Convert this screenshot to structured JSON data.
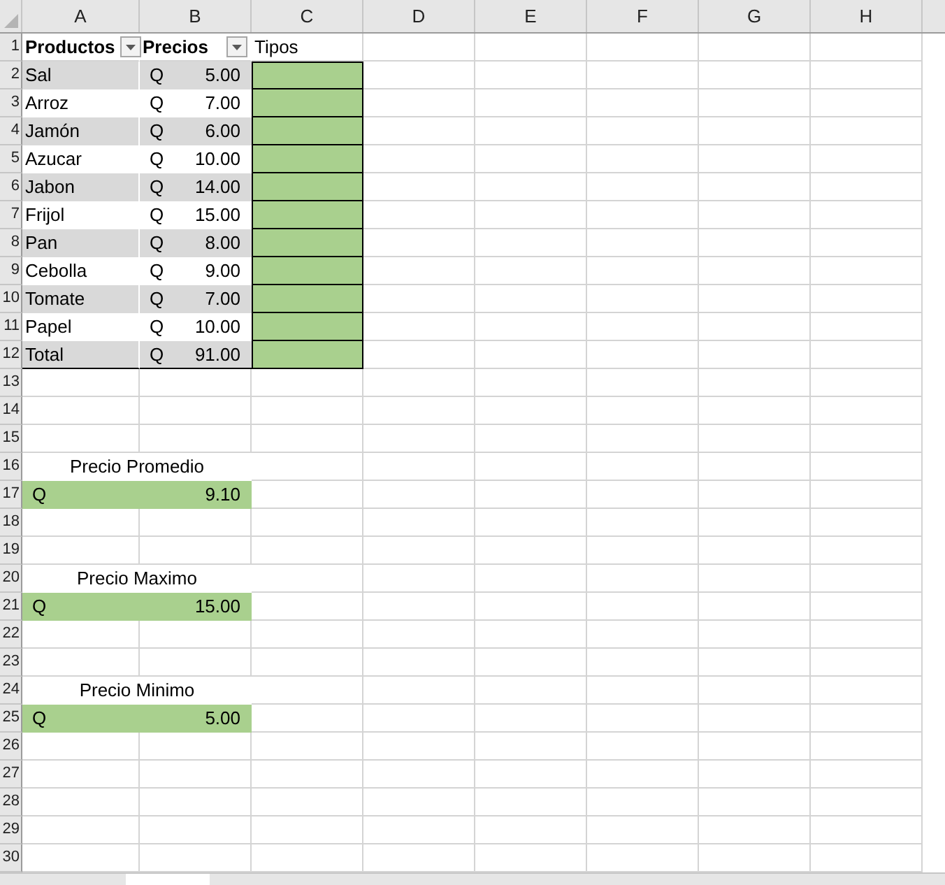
{
  "column_headers": [
    "A",
    "B",
    "C",
    "D",
    "E",
    "F",
    "G",
    "H"
  ],
  "row_headers": [
    "1",
    "2",
    "3",
    "4",
    "5",
    "6",
    "7",
    "8",
    "9",
    "10",
    "11",
    "12",
    "13",
    "14",
    "15",
    "16",
    "17",
    "18",
    "19",
    "20",
    "21",
    "22",
    "23",
    "24",
    "25",
    "26",
    "27",
    "28",
    "29",
    "30"
  ],
  "table": {
    "columns": [
      {
        "label": "Productos",
        "filter": true
      },
      {
        "label": "Precios",
        "filter": true
      },
      {
        "label": "Tipos",
        "filter": false
      }
    ],
    "rows": [
      {
        "product": "Sal",
        "currency": "Q",
        "price": "5.00"
      },
      {
        "product": "Arroz",
        "currency": "Q",
        "price": "7.00"
      },
      {
        "product": "Jamón",
        "currency": "Q",
        "price": "6.00"
      },
      {
        "product": "Azucar",
        "currency": "Q",
        "price": "10.00"
      },
      {
        "product": "Jabon",
        "currency": "Q",
        "price": "14.00"
      },
      {
        "product": "Frijol",
        "currency": "Q",
        "price": "15.00"
      },
      {
        "product": "Pan",
        "currency": "Q",
        "price": "8.00"
      },
      {
        "product": "Cebolla",
        "currency": "Q",
        "price": "9.00"
      },
      {
        "product": "Tomate",
        "currency": "Q",
        "price": "7.00"
      },
      {
        "product": "Papel",
        "currency": "Q",
        "price": "10.00"
      },
      {
        "product": "Total",
        "currency": "Q",
        "price": "91.00"
      }
    ]
  },
  "summaries": [
    {
      "label": "Precio Promedio",
      "currency": "Q",
      "value": "9.10"
    },
    {
      "label": "Precio Maximo",
      "currency": "Q",
      "value": "15.00"
    },
    {
      "label": "Precio Minimo",
      "currency": "Q",
      "value": "5.00"
    }
  ]
}
